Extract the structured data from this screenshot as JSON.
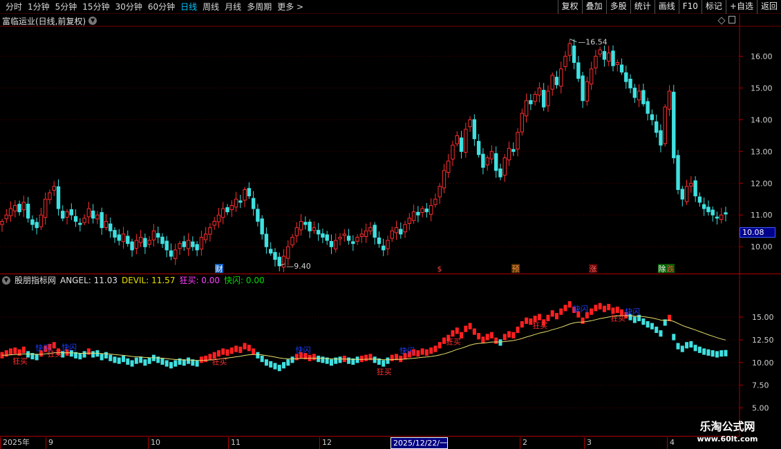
{
  "toolbar": {
    "periods": [
      "分时",
      "1分钟",
      "5分钟",
      "15分钟",
      "30分钟",
      "60分钟",
      "日线",
      "周线",
      "月线",
      "多周期",
      "更多 >"
    ],
    "active_period": "日线",
    "tools": [
      "复权",
      "叠加",
      "多股",
      "统计",
      "画线",
      "F10",
      "标记",
      "+自选",
      "返回"
    ]
  },
  "main": {
    "stock_name": "富临运业(日线,前复权)",
    "price_axis": [
      "16.00",
      "15.00",
      "14.00",
      "13.00",
      "12.00",
      "11.00",
      "10.00"
    ],
    "current_price_label": "10.08",
    "high_label": "16.54",
    "low_label": "9.40",
    "event_markers": [
      "财",
      "$",
      "预",
      "涨",
      "除",
      "跌"
    ]
  },
  "indicator": {
    "name": "股朋指标网",
    "angel": "ANGEL: 11.03",
    "devil": "DEVIL: 11.57",
    "kuangmai": "狂买: 0.00",
    "kuaishan": "快闪: 0.00",
    "axis": [
      "15.00",
      "12.50",
      "10.00",
      "7.50",
      "5.00"
    ],
    "signal_kuangmai": "狂买",
    "signal_kuaishan": "快闪"
  },
  "date_axis": {
    "labels": [
      "2025年",
      "9",
      "10",
      "11",
      "12",
      "2025/12/22/一",
      "2",
      "3",
      "4"
    ],
    "cursor_label": "2025/12/22/一"
  },
  "watermark": {
    "title": "乐淘公式网",
    "url": "www.60lt.com"
  },
  "chart_data": {
    "type": "candlestick",
    "title": "富临运业(日线,前复权)",
    "ylim": [
      9.2,
      16.9
    ],
    "period_high": 16.54,
    "period_low": 9.4,
    "close_series": [
      10.8,
      11.0,
      11.2,
      11.3,
      11.1,
      11.4,
      10.9,
      10.7,
      10.6,
      11.0,
      11.5,
      11.7,
      11.9,
      11.2,
      10.9,
      11.1,
      11.0,
      10.8,
      10.7,
      10.9,
      11.2,
      10.9,
      11.0,
      10.6,
      10.8,
      10.5,
      10.3,
      10.2,
      10.4,
      10.1,
      9.9,
      10.2,
      10.3,
      10.0,
      10.2,
      10.5,
      10.3,
      10.1,
      9.9,
      9.7,
      9.9,
      10.1,
      10.0,
      10.2,
      10.0,
      9.9,
      10.3,
      10.4,
      10.6,
      10.8,
      11.0,
      11.2,
      11.1,
      11.3,
      11.5,
      11.4,
      11.8,
      11.6,
      11.2,
      10.8,
      10.4,
      10.0,
      9.8,
      9.6,
      9.4,
      9.7,
      10.0,
      10.3,
      10.6,
      10.8,
      10.7,
      10.5,
      10.6,
      10.4,
      10.3,
      10.2,
      10.0,
      10.2,
      10.3,
      10.4,
      10.2,
      10.1,
      10.3,
      10.4,
      10.5,
      10.6,
      10.3,
      10.1,
      9.9,
      10.2,
      10.5,
      10.6,
      10.4,
      10.7,
      10.9,
      11.1,
      11.0,
      11.2,
      11.1,
      11.3,
      11.5,
      11.9,
      12.4,
      12.7,
      13.2,
      13.5,
      13.0,
      13.7,
      14.0,
      13.4,
      12.9,
      12.5,
      12.8,
      13.0,
      12.4,
      12.2,
      12.8,
      13.1,
      13.0,
      13.6,
      14.2,
      14.6,
      14.5,
      14.8,
      15.0,
      14.4,
      14.9,
      15.4,
      15.1,
      15.6,
      16.0,
      16.4,
      15.8,
      15.3,
      14.6,
      15.2,
      15.6,
      16.0,
      16.2,
      15.9,
      16.1,
      15.7,
      15.8,
      15.5,
      15.2,
      15.0,
      14.7,
      14.9,
      14.5,
      14.2,
      14.0,
      13.6,
      13.2,
      14.4,
      14.9,
      12.8,
      11.8,
      11.5,
      11.9,
      12.0,
      11.6,
      11.4,
      11.2,
      11.1,
      11.0,
      10.9,
      11.0,
      11.03
    ],
    "series": [
      {
        "name": "ANGEL",
        "last": 11.03
      },
      {
        "name": "DEVIL",
        "last": 11.57
      }
    ]
  }
}
